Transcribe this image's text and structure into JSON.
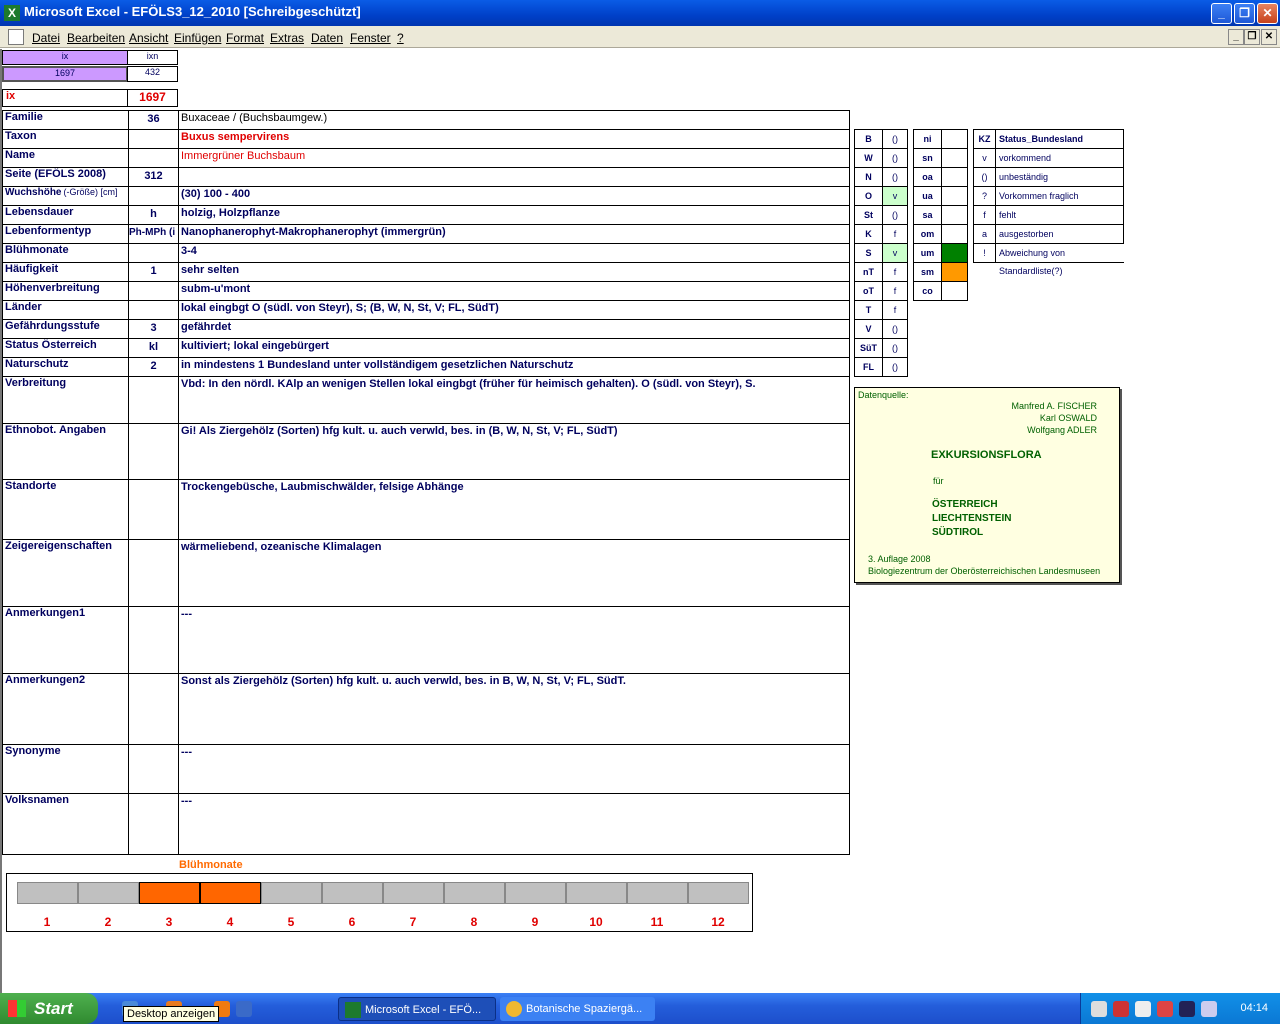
{
  "window": {
    "title": "Microsoft Excel - EFÖLS3_12_2010  [Schreibgeschützt]",
    "min": "_",
    "max": "❐",
    "close": "✕"
  },
  "menu": [
    "Datei",
    "Bearbeiten",
    "Ansicht",
    "Einfügen",
    "Format",
    "Extras",
    "Daten",
    "Fenster",
    "?"
  ],
  "top": {
    "ix_head": "ix",
    "ixn_head": "ixn",
    "ix_val": "1697",
    "ixn_val": "432",
    "ix_label": "ix",
    "ix_big": "1697"
  },
  "rows": [
    {
      "label": "Familie",
      "mid": "36",
      "value": "Buxaceae  /  (Buchsbaumgew.)"
    },
    {
      "label": "Taxon",
      "mid": "",
      "value": "Buxus sempervirens"
    },
    {
      "label": "Name",
      "mid": "",
      "value": "Immergrüner Buchsbaum"
    },
    {
      "label": "Seite (EFÖLS 2008)",
      "mid": "312",
      "value": ""
    },
    {
      "label": "Wuchshöhe",
      "label2": "(-Größe) [cm]",
      "mid": "",
      "value": "(30) 100 - 400"
    },
    {
      "label": "Lebensdauer",
      "mid": "h",
      "value": "holzig, Holzpflanze"
    },
    {
      "label": "Lebenformentyp",
      "mid": "Ph-MPh (i",
      "value": "Nanophanerophyt-Makrophanerophyt (immergrün)"
    },
    {
      "label": "Blühmonate",
      "mid": "",
      "value": "3-4"
    },
    {
      "label": "Häufigkeit",
      "mid": "1",
      "value": "sehr selten"
    },
    {
      "label": "Höhenverbreitung",
      "mid": "",
      "value": "subm-u'mont"
    },
    {
      "label": "Länder",
      "mid": "",
      "value": "lokal eingbgt  O (südl. von Steyr), S; (B, W, N, St, V; FL, SüdT)"
    },
    {
      "label": "Gefährdungsstufe",
      "mid": "3",
      "value": "gefährdet"
    },
    {
      "label": "Status Österreich",
      "mid": "kl",
      "value": "kultiviert; lokal eingebürgert"
    },
    {
      "label": "Naturschutz",
      "mid": "2",
      "value": "in mindestens 1 Bundesland unter vollständigem gesetzlichen Naturschutz"
    },
    {
      "label": "Verbreitung",
      "mid": "",
      "value": "Vbd: In den nördl. KAlp an wenigen Stellen lokal eingbgt (früher für heimisch gehalten). O (südl. von Steyr), S."
    },
    {
      "label": "Ethnobot. Angaben",
      "mid": "",
      "value": "Gi!  Als Ziergehölz (Sorten) hfg kult. u. auch verwld, bes. in (B, W, N, St, V; FL, SüdT)"
    },
    {
      "label": "Standorte",
      "mid": "",
      "value": "Trockengebüsche, Laubmischwälder, felsige Abhänge"
    },
    {
      "label": "Zeigereigenschaften",
      "mid": "",
      "value": "wärmeliebend, ozeanische Klimalagen"
    },
    {
      "label": "Anmerkungen1",
      "mid": "",
      "value": "---"
    },
    {
      "label": "Anmerkungen2",
      "mid": "",
      "value": "Sonst als Ziergehölz (Sorten) hfg kult. u. auch verwld, bes. in B, W, N, St, V; FL, SüdT."
    },
    {
      "label": "Synonyme",
      "mid": "",
      "value": "---"
    },
    {
      "label": "Volksnamen",
      "mid": "",
      "value": "---"
    }
  ],
  "states": [
    {
      "k": "B",
      "v": "()"
    },
    {
      "k": "W",
      "v": "()"
    },
    {
      "k": "N",
      "v": "()"
    },
    {
      "k": "O",
      "v": "v"
    },
    {
      "k": "St",
      "v": "()"
    },
    {
      "k": "K",
      "v": "f"
    },
    {
      "k": "S",
      "v": "v"
    },
    {
      "k": "nT",
      "v": "f"
    },
    {
      "k": "oT",
      "v": "f"
    },
    {
      "k": "T",
      "v": "f"
    },
    {
      "k": "V",
      "v": "()"
    },
    {
      "k": "SüT",
      "v": "()"
    },
    {
      "k": "FL",
      "v": "()"
    }
  ],
  "alt": [
    {
      "k": "ni",
      "v": ""
    },
    {
      "k": "sn",
      "v": ""
    },
    {
      "k": "oa",
      "v": ""
    },
    {
      "k": "ua",
      "v": ""
    },
    {
      "k": "sa",
      "v": ""
    },
    {
      "k": "om",
      "v": ""
    },
    {
      "k": "um",
      "v": "",
      "color": "#008000"
    },
    {
      "k": "sm",
      "v": "",
      "color": "#ff9900"
    },
    {
      "k": "co",
      "v": ""
    }
  ],
  "status_legend": {
    "head_k": "KZ",
    "head_v": "Status_Bundesland",
    "items": [
      {
        "k": "v",
        "v": "vorkommend"
      },
      {
        "k": "()",
        "v": "unbeständig"
      },
      {
        "k": "?",
        "v": "Vorkommen fraglich"
      },
      {
        "k": "f",
        "v": "fehlt"
      },
      {
        "k": "a",
        "v": "ausgestorben"
      },
      {
        "k": "!",
        "v": "Abweichung von Standardliste(?)"
      }
    ]
  },
  "source": {
    "label": "Datenquelle:",
    "authors": [
      "Manfred A. FISCHER",
      "Karl OSWALD",
      "Wolfgang ADLER"
    ],
    "book": "EXKURSIONSFLORA",
    "fuer": "für",
    "regions": [
      "ÖSTERREICH",
      "LIECHTENSTEIN",
      "SÜDTIROL"
    ],
    "edition": "3. Auflage 2008",
    "publisher": "Biologiezentrum der Oberösterreichischen Landesmuseen"
  },
  "bloom": {
    "title": "Blühmonate",
    "months": [
      "1",
      "2",
      "3",
      "4",
      "5",
      "6",
      "7",
      "8",
      "9",
      "10",
      "11",
      "12"
    ],
    "active": [
      false,
      false,
      true,
      true,
      false,
      false,
      false,
      false,
      false,
      false,
      false,
      false
    ]
  },
  "taskbar": {
    "start": "Start",
    "tooltip": "Desktop anzeigen",
    "btn1": "Microsoft Excel - EFÖ...",
    "btn2": "Botanische Spaziergä...",
    "clock": "04:14"
  }
}
